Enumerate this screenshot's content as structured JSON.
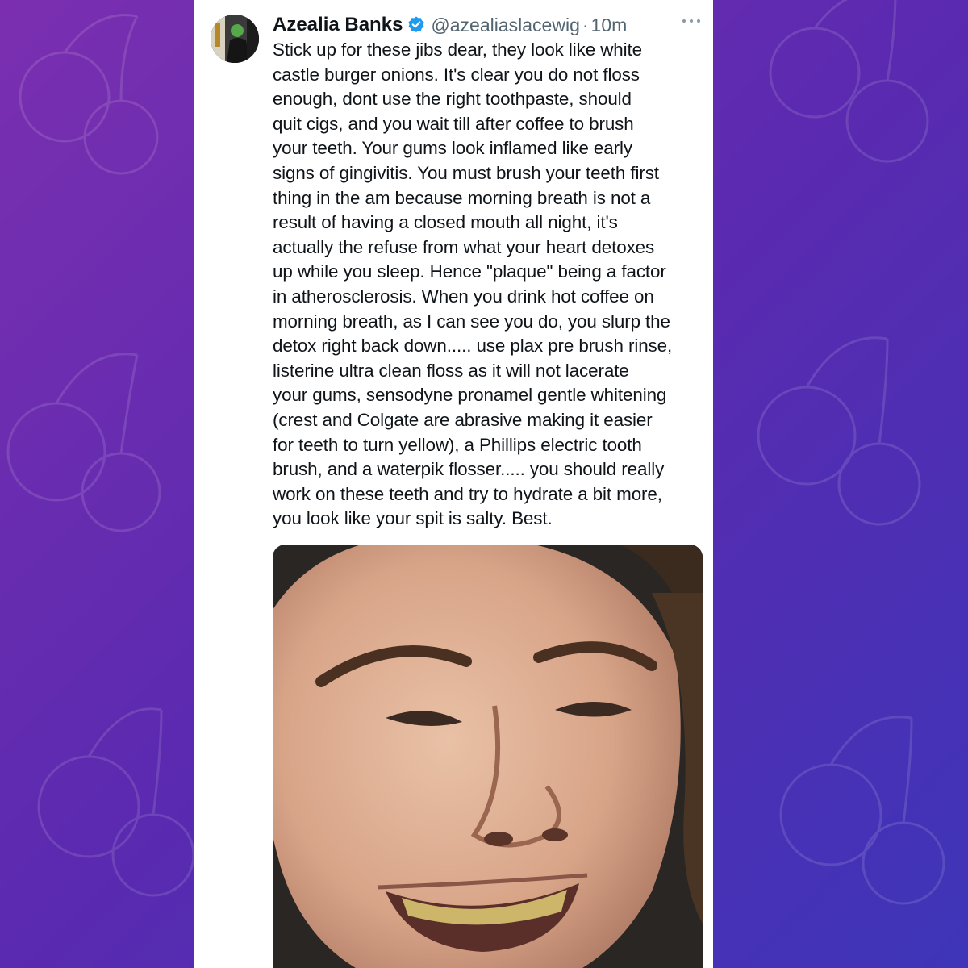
{
  "tweet": {
    "author_name": "Azealia Banks",
    "handle": "@azealiaslacewig",
    "separator": "·",
    "time": "10m",
    "text": "Stick up for these jibs dear, they look like white\ncastle burger onions. It's clear you do not floss\nenough, dont use the right toothpaste, should\nquit cigs, and you wait till after coffee to brush\nyour teeth. Your gums look inflamed like early\nsigns of gingivitis. You must brush your teeth first\nthing in the am because morning breath is not a\nresult of having a closed mouth all night, it's\nactually the refuse from what your heart detoxes\nup while you sleep. Hence \"plaque\" being a factor\nin atherosclerosis. When you drink hot coffee on\nmorning breath, as I can see you do, you slurp the\ndetox right back down..... use plax pre brush rinse,\nlisterine ultra clean floss as it will not lacerate\nyour gums, sensodyne pronamel gentle whitening\n(crest and Colgate are abrasive making it easier\nfor teeth to turn yellow), a Phillips electric tooth\nbrush, and a waterpik flosser..... you should really\nwork on these teeth and try to hydrate a bit more,\nyou look like your spit is salty. Best."
  },
  "icons": {
    "verified": "verified-badge-icon",
    "more": "more-options-icon"
  },
  "colors": {
    "background_start": "#7b2fb0",
    "background_end": "#3e35b8",
    "verified_blue": "#1d9bf0",
    "text_primary": "#0f1419",
    "text_secondary": "#536471"
  }
}
